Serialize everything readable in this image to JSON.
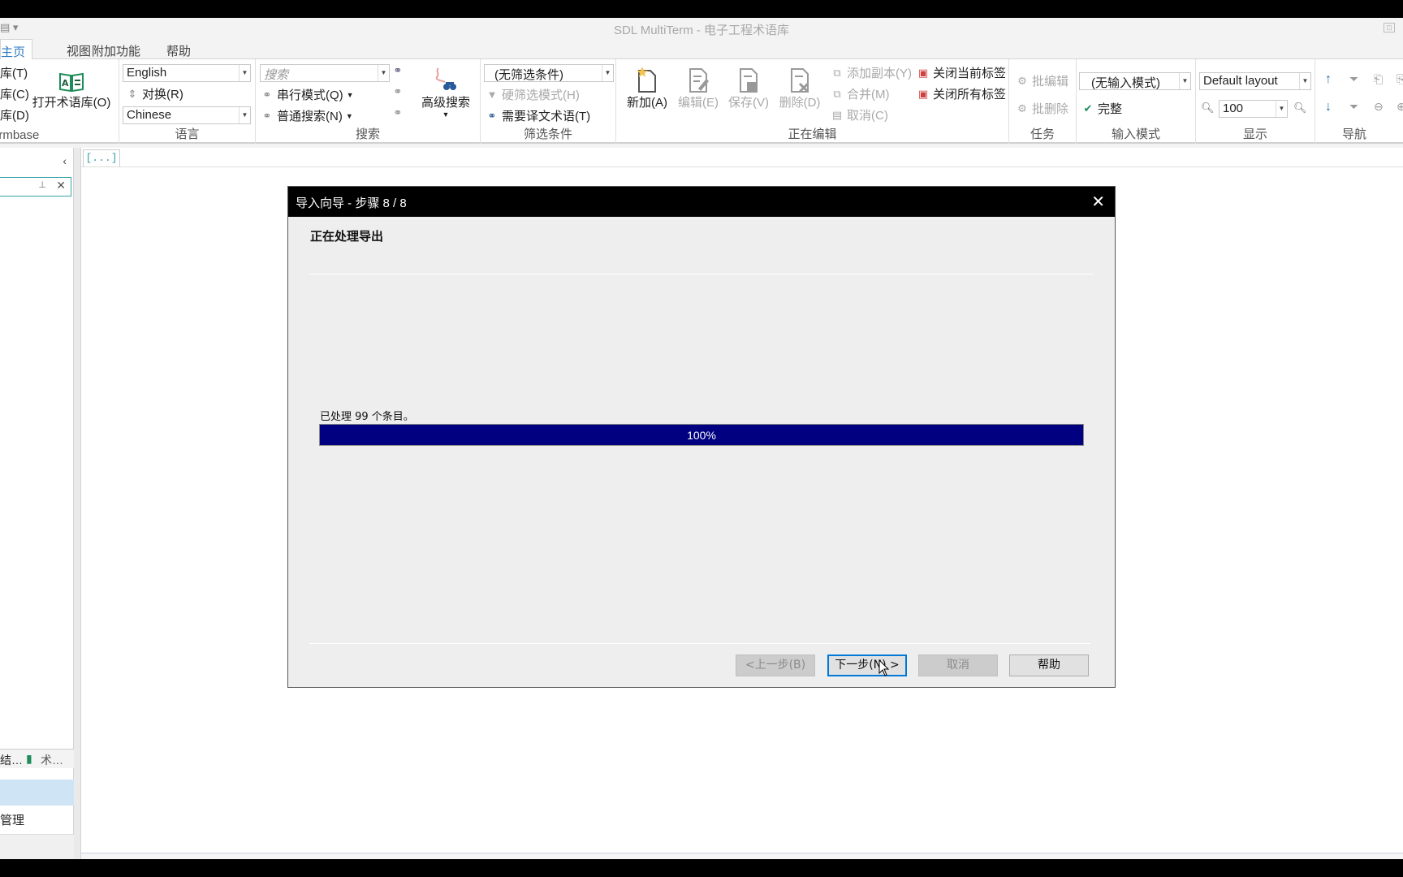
{
  "window": {
    "title": "SDL MultiTerm - 电子工程术语库",
    "quick_access_icon": "document-icon"
  },
  "tabs": [
    {
      "label": "主页",
      "active": true
    },
    {
      "label": "视图",
      "active": false
    },
    {
      "label": "附加功能",
      "active": false
    },
    {
      "label": "帮助",
      "active": false
    }
  ],
  "ribbon": {
    "termbase": {
      "label": "Termbase",
      "items": [
        "库(T)",
        "库(C)",
        "库(D)"
      ],
      "open_label": "打开术语库(O)"
    },
    "language": {
      "label": "语言",
      "source": "English",
      "swap": "对换(R)",
      "target": "Chinese"
    },
    "search": {
      "label": "搜索",
      "placeholder": "搜索",
      "serial_mode": "串行模式(Q)",
      "normal_search": "普通搜索(N)",
      "advanced": "高级搜索"
    },
    "filter": {
      "label": "筛选条件",
      "value": "(无筛选条件)",
      "hard_filter": "硬筛选模式(H)",
      "need_target": "需要译文术语(T)"
    },
    "editing": {
      "label": "正在编辑",
      "new": "新加(A)",
      "edit": "编辑(E)",
      "save": "保存(V)",
      "delete": "删除(D)",
      "add_copy": "添加副本(Y)",
      "merge": "合并(M)",
      "cancel": "取消(C)",
      "close_current": "关闭当前标签",
      "close_all": "关闭所有标签"
    },
    "tasks": {
      "label": "任务",
      "batch_edit": "批编辑",
      "batch_delete": "批删除"
    },
    "input_mode": {
      "label": "输入模式",
      "value": "(无输入模式)",
      "complete": "完整"
    },
    "display": {
      "label": "显示",
      "layout": "Default layout",
      "zoom": "100"
    },
    "navigation": {
      "label": "导航"
    }
  },
  "left_panel": {
    "bottom_tabs": [
      "结…",
      "术…"
    ],
    "item": "管理"
  },
  "document_tab": "[...]",
  "dialog": {
    "title": "导入向导 - 步骤 8 / 8",
    "heading": "正在处理导出",
    "status": "已处理 99 个条目。",
    "progress_percent": 100,
    "progress_label": "100%",
    "buttons": {
      "back": "<上一步(B)",
      "next": "下一步(N) >",
      "cancel": "取消",
      "help": "帮助"
    },
    "progress_color": "#000080"
  }
}
